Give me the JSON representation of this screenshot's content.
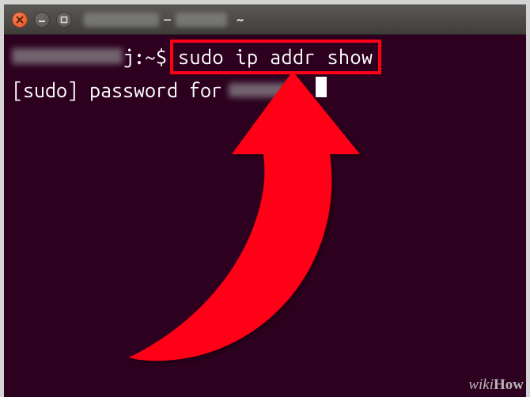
{
  "titlebar": {
    "separator": "~",
    "at_symbol": "—"
  },
  "terminal": {
    "prompt_suffix": "j:~$",
    "command": "sudo ip addr show",
    "password_prompt": "[sudo] password for",
    "colon": ":"
  },
  "watermark": {
    "wiki": "wiki",
    "how": "How"
  },
  "colors": {
    "terminal_bg": "#2c001e",
    "highlight_red": "#ff0016",
    "close_btn": "#e95420"
  }
}
